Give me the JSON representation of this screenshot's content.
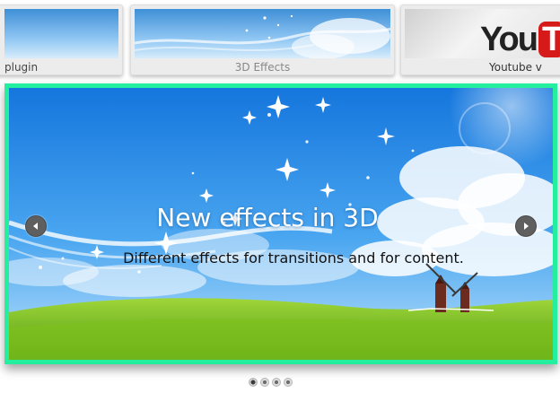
{
  "thumbnails": [
    {
      "caption": "plugin"
    },
    {
      "caption": "3D Effects"
    },
    {
      "caption": "Youtube v",
      "logo_left": "You",
      "logo_right": "T"
    }
  ],
  "slide": {
    "title": "New effects in 3D",
    "subtitle": "Different effects for transitions and for content."
  },
  "controls": {
    "prev_icon": "chevron-left-icon",
    "next_icon": "chevron-right-icon"
  },
  "pager": {
    "count": 4,
    "active_index": 0
  },
  "colors": {
    "slider_border": "#23ef9f",
    "sky_top": "#1f7fe0",
    "grass": "#7cc41e",
    "title_text": "#ffffff",
    "subtitle_text": "#111111"
  }
}
